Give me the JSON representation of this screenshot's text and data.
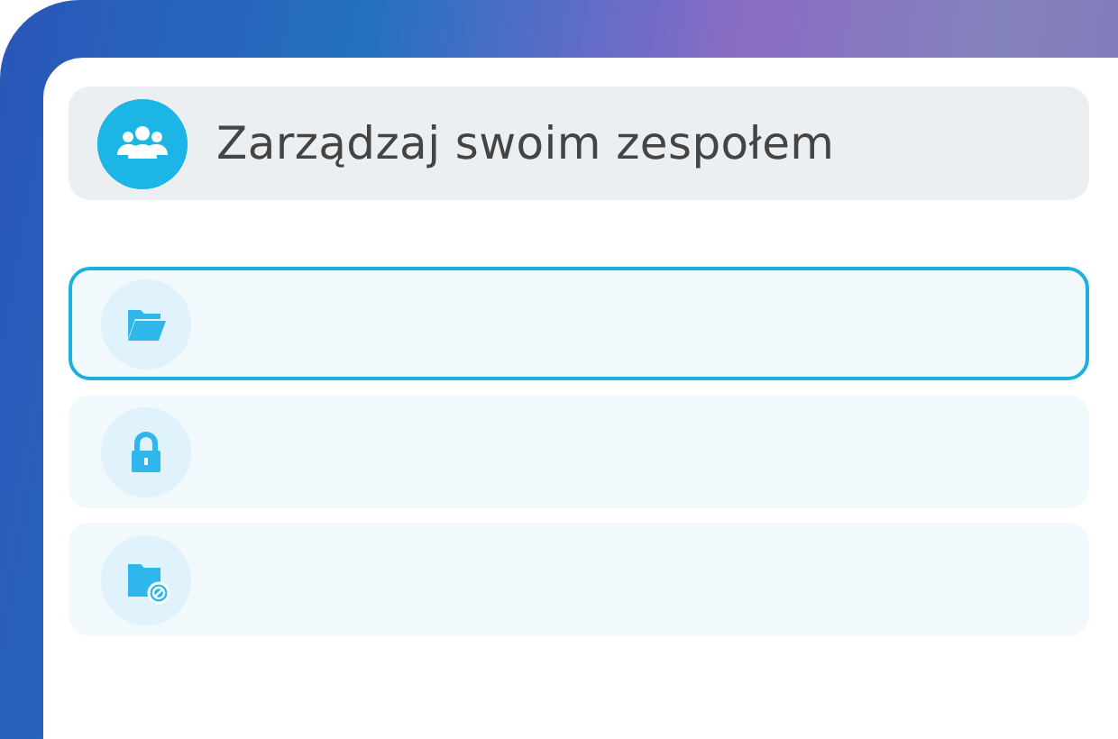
{
  "header": {
    "title": "Zarządzaj swoim zespołem"
  },
  "items": [
    {
      "kind": "folder-open",
      "selected": true
    },
    {
      "kind": "lock",
      "selected": false
    },
    {
      "kind": "folder-blocked",
      "selected": false
    }
  ]
}
